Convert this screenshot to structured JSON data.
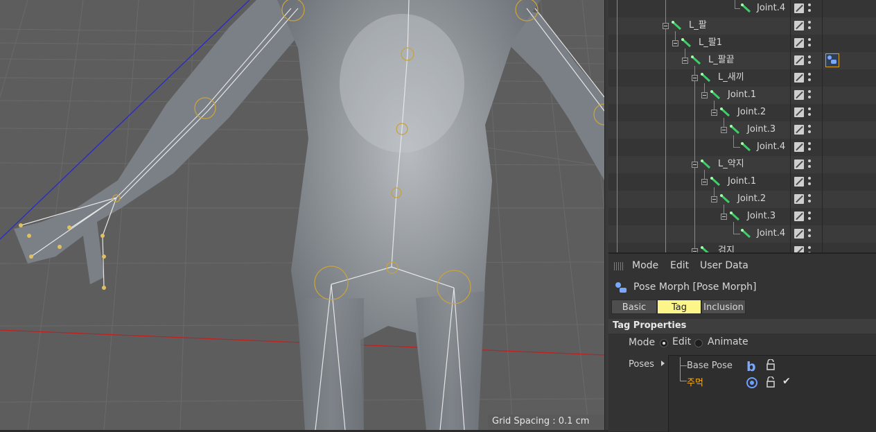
{
  "viewport": {
    "grid_spacing_text": "Grid Spacing : 0.1 cm"
  },
  "object_manager": {
    "rows": [
      {
        "label": "Joint.4",
        "expandable": false
      },
      {
        "label": "L_팔",
        "expandable": true
      },
      {
        "label": "L_팔1",
        "expandable": true
      },
      {
        "label": "L_팔끝",
        "expandable": true,
        "has_tag": true
      },
      {
        "label": "L_새끼",
        "expandable": true
      },
      {
        "label": "Joint.1",
        "expandable": true
      },
      {
        "label": "Joint.2",
        "expandable": true
      },
      {
        "label": "Joint.3",
        "expandable": true
      },
      {
        "label": "Joint.4",
        "expandable": false
      },
      {
        "label": "L_약지",
        "expandable": true
      },
      {
        "label": "Joint.1",
        "expandable": true
      },
      {
        "label": "Joint.2",
        "expandable": true
      },
      {
        "label": "Joint.3",
        "expandable": true
      },
      {
        "label": "Joint.4",
        "expandable": false
      },
      {
        "label": "검지",
        "expandable": true
      }
    ],
    "icons": {
      "joint": "joint-icon",
      "visibility": "visibility-icon",
      "tag": "pose-morph-tag-icon"
    }
  },
  "attribute_manager": {
    "menu": {
      "mode": "Mode",
      "edit": "Edit",
      "user_data": "User Data"
    },
    "object_title": "Pose Morph [Pose Morph]",
    "tabs": {
      "basic": "Basic",
      "tag": "Tag",
      "inclusion": "Inclusion"
    },
    "active_tab": "Tag",
    "section_title": "Tag Properties",
    "mode_label": "Mode",
    "mode_options": {
      "edit": "Edit",
      "animate": "Animate"
    },
    "mode_selected": "Edit",
    "poses_label": "Poses",
    "poses": {
      "base": "Base Pose",
      "selected": "주먹"
    }
  },
  "colors": {
    "active_tab": "#fbf58a",
    "selected_pose": "#ffb020",
    "joint_ring": "#c9a23c",
    "accent_blue": "#6fa0ff"
  }
}
